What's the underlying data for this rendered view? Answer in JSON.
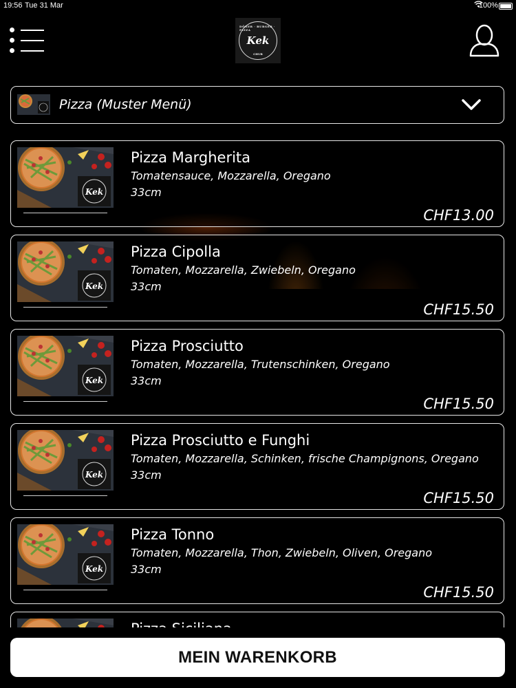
{
  "status_bar": {
    "time": "19:56",
    "date": "Tue 31 Mar",
    "battery": "100%"
  },
  "header": {
    "logo": {
      "script": "Kek",
      "top_text": "DÖNER · BURGER · PIZZA",
      "bottom_text": "CHUR"
    }
  },
  "category": {
    "label": "Pizza (Muster Menü)"
  },
  "items": [
    {
      "name": "Pizza Margherita",
      "desc": "Tomatensauce, Mozzarella, Oregano",
      "size": "33cm",
      "price": "CHF13.00"
    },
    {
      "name": "Pizza Cipolla",
      "desc": "Tomaten, Mozzarella, Zwiebeln, Oregano",
      "size": "33cm",
      "price": "CHF15.50"
    },
    {
      "name": "Pizza Prosciutto",
      "desc": "Tomaten, Mozzarella, Trutenschinken, Oregano",
      "size": "33cm",
      "price": "CHF15.50"
    },
    {
      "name": "Pizza Prosciutto e Funghi",
      "desc": "Tomaten, Mozzarella, Schinken, frische Champignons, Oregano",
      "size": "33cm",
      "price": "CHF15.50"
    },
    {
      "name": "Pizza Tonno",
      "desc": "Tomaten, Mozzarella, Thon, Zwiebeln, Oliven, Oregano",
      "size": "33cm",
      "price": "CHF15.50"
    },
    {
      "name": "Pizza Siciliana",
      "desc": "",
      "size": "",
      "price": ""
    }
  ],
  "cart_button": {
    "label": "MEIN WARENKORB"
  },
  "colors": {
    "background": "#000000",
    "border": "#e8e8e8",
    "button_bg": "#ffffff",
    "button_text": "#111111"
  }
}
